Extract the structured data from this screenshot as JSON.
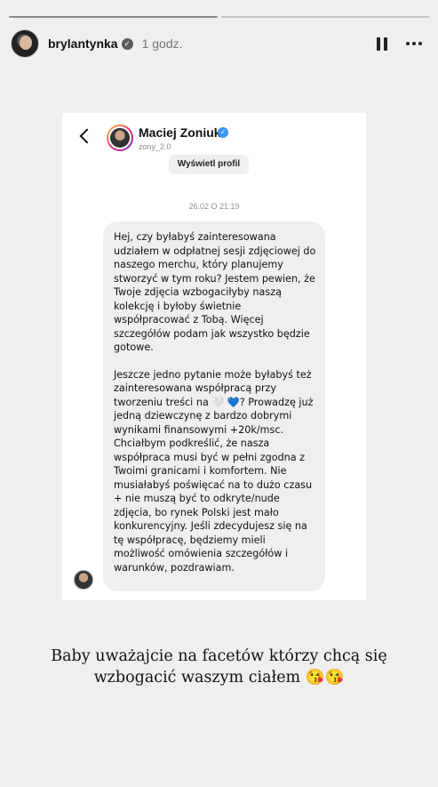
{
  "story": {
    "progress": [
      1,
      0
    ],
    "user": {
      "username": "brylantynka",
      "time": "1 godz."
    },
    "icons": {
      "pause": "pause-icon",
      "more": "more-icon",
      "verified": "verified-badge-icon"
    }
  },
  "dm": {
    "contact_name": "Maciej Zoniuk",
    "contact_handle": "zony_2.0",
    "profile_button": "Wyświetl profil",
    "date_stamp": "26.02 O 21:19",
    "message_p1": "Hej, czy byłabyś zainteresowana udziałem w odpłatnej sesji zdjęciowej do naszego merchu, który planujemy stworzyć w tym roku? Jestem pewien, że Twoje zdjęcia wzbogaciłyby naszą kolekcję i byłoby świetnie współpracować z Tobą. Więcej szczegółów podam jak wszystko będzie gotowe.",
    "message_p2": "Jeszcze jedno pytanie może byłabyś też zainteresowana współpracą przy tworzeniu treści na 🤍 💙? Prowadzę już jedną dziewczynę z bardzo dobrymi wynikami finansowymi +20k/msc. Chciałbym podkreślić, że nasza współpraca musi być w pełni zgodna z Twoimi granicami i komfortem. Nie musiałabyś poświęcać na to dużo czasu + nie muszą być to odkryte/nude zdjęcia, bo rynek Polski jest mało konkurencyjny. Jeśli zdecydujesz się na tę współpracę, będziemy mieli możliwość omówienia szczegółów i warunków, pozdrawiam."
  },
  "caption": {
    "line1": "Baby uważajcie na facetów którzy chcą się",
    "line2": "wzbogacić waszym ciałem 😘😘"
  },
  "colors": {
    "background": "#efefef",
    "bubble": "#efefef",
    "verified_blue": "#3897f0"
  }
}
